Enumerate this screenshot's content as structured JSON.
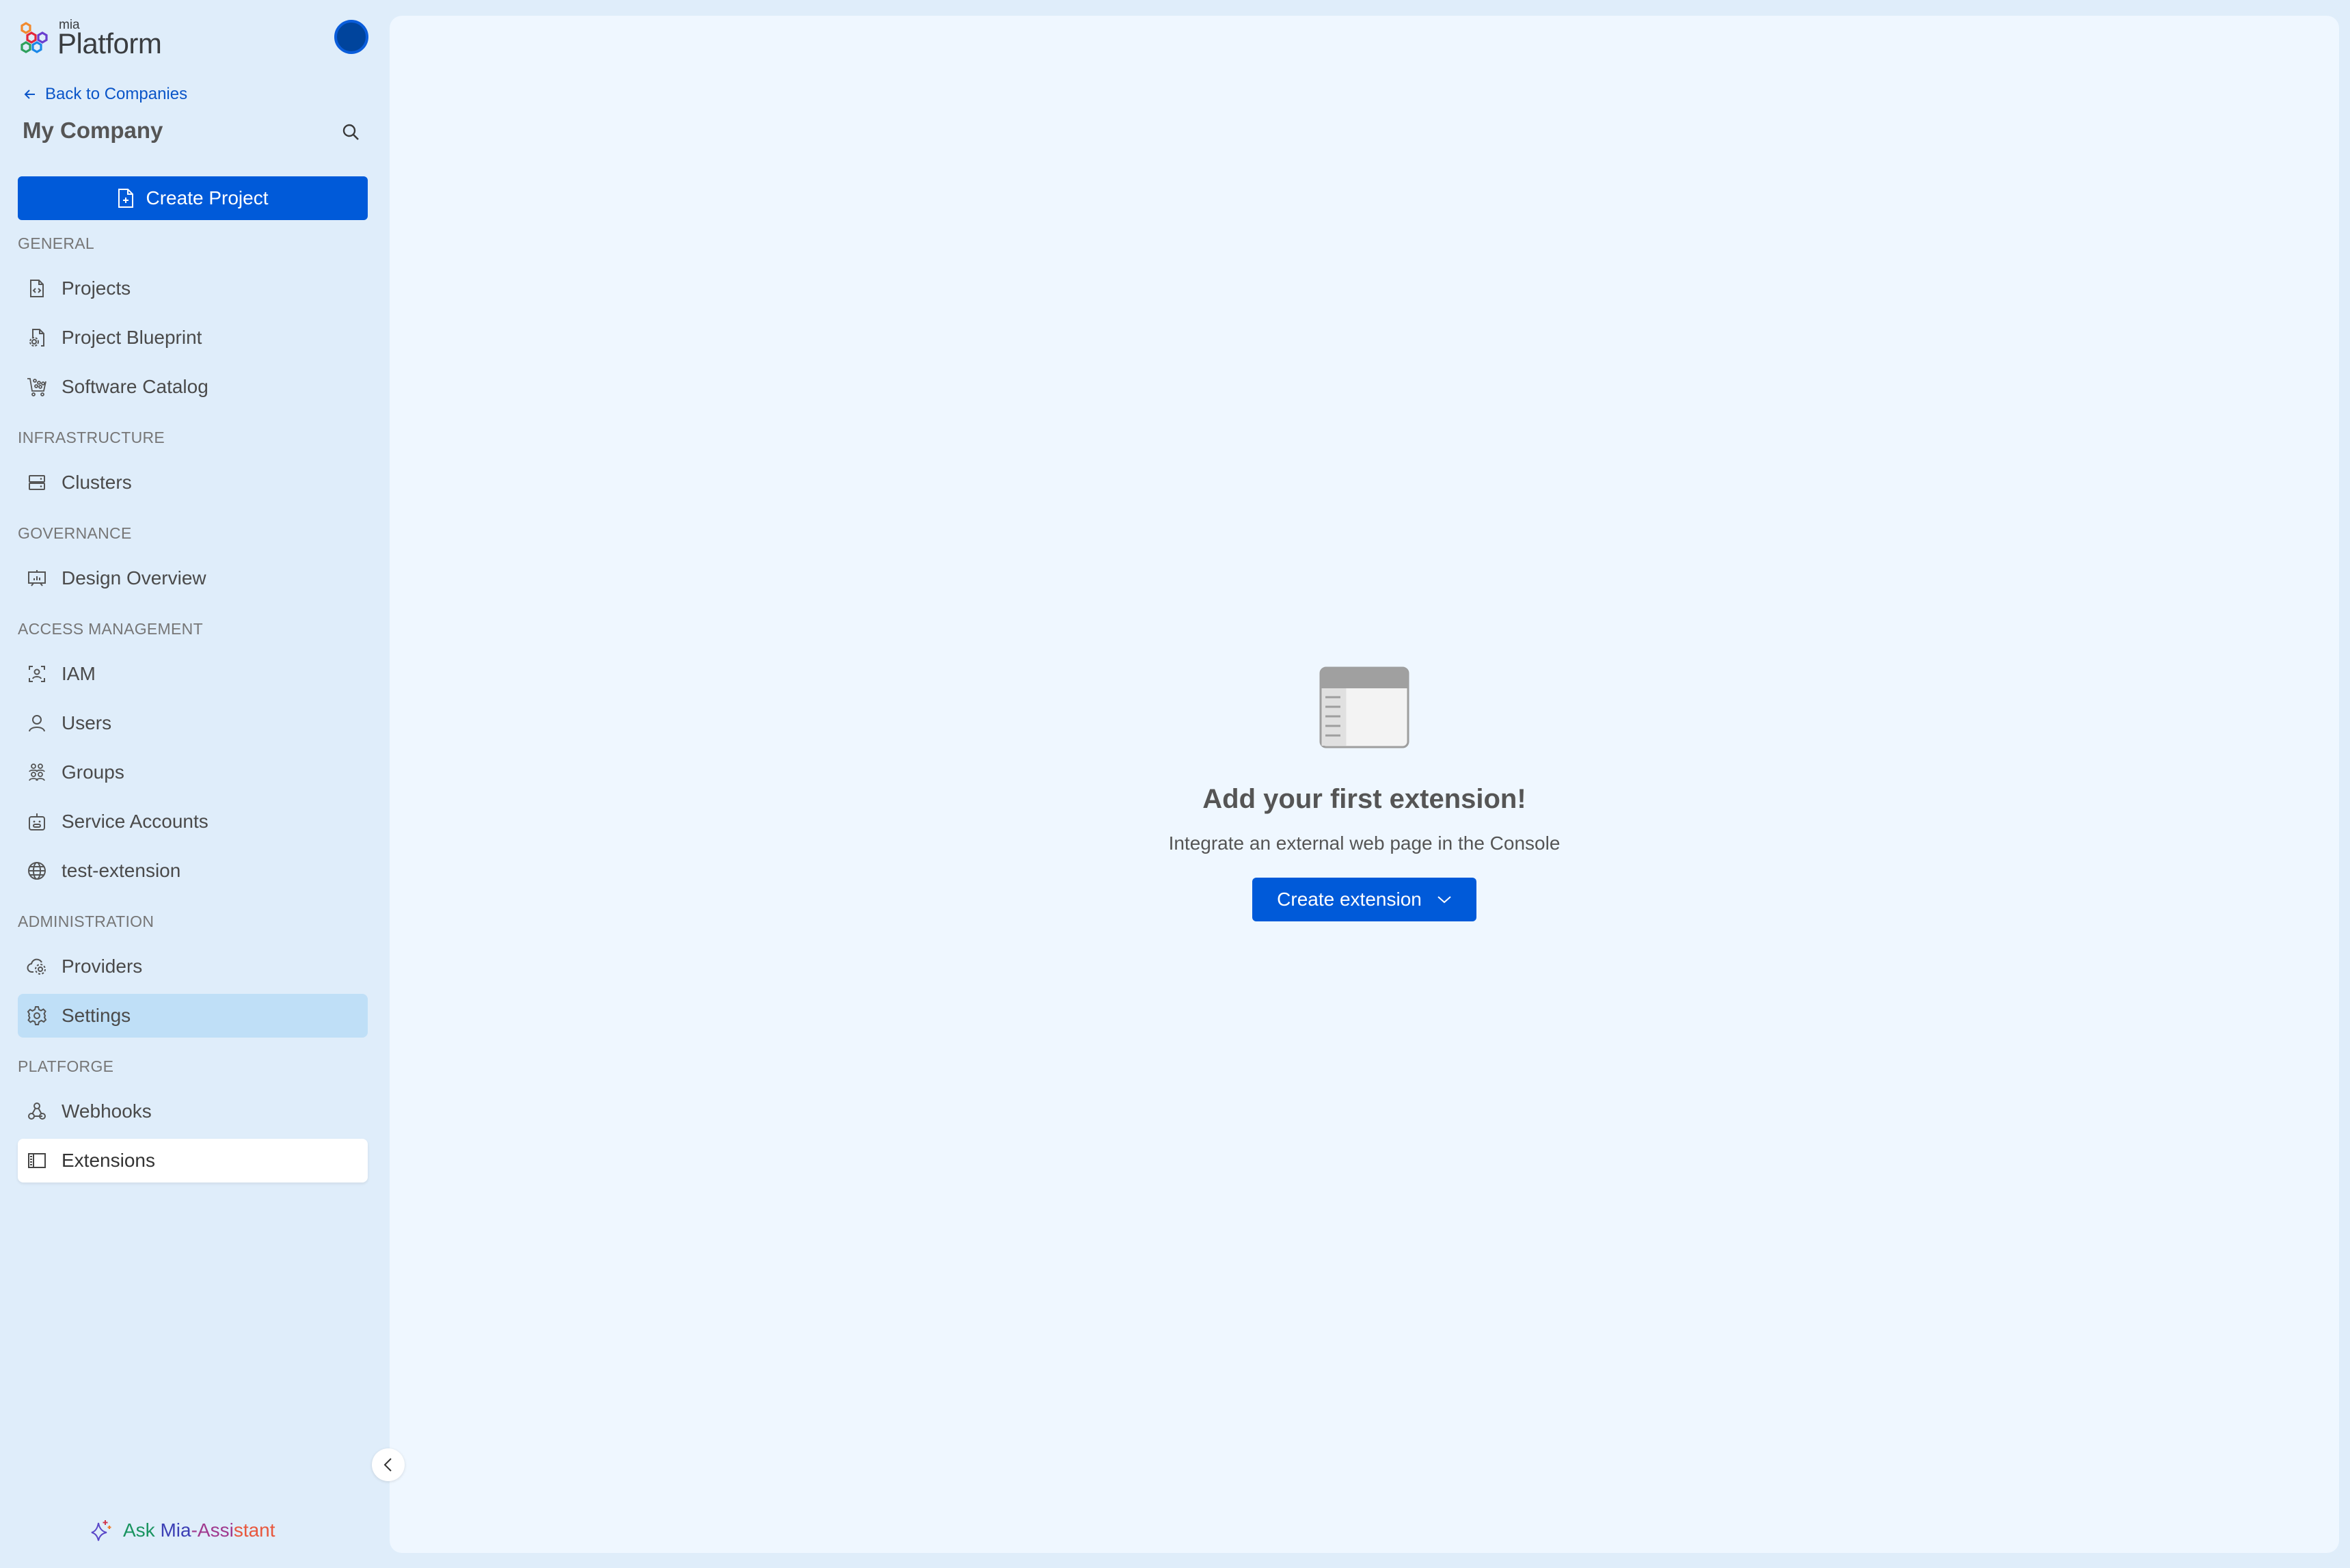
{
  "brand": {
    "small": "mia",
    "name": "Platform"
  },
  "header": {
    "back_label": "Back to Companies",
    "company_name": "My Company",
    "create_project_label": "Create Project"
  },
  "sidebar": {
    "sections": [
      {
        "title": "GENERAL",
        "items": [
          {
            "label": "Projects",
            "icon": "file-code-icon"
          },
          {
            "label": "Project Blueprint",
            "icon": "file-gear-icon"
          },
          {
            "label": "Software Catalog",
            "icon": "cart-icon"
          }
        ]
      },
      {
        "title": "INFRASTRUCTURE",
        "items": [
          {
            "label": "Clusters",
            "icon": "server-icon"
          }
        ]
      },
      {
        "title": "GOVERNANCE",
        "items": [
          {
            "label": "Design Overview",
            "icon": "presentation-chart-icon"
          }
        ]
      },
      {
        "title": "ACCESS MANAGEMENT",
        "items": [
          {
            "label": "IAM",
            "icon": "user-scan-icon"
          },
          {
            "label": "Users",
            "icon": "user-icon"
          },
          {
            "label": "Groups",
            "icon": "users-group-icon"
          },
          {
            "label": "Service Accounts",
            "icon": "robot-icon"
          },
          {
            "label": "test-extension",
            "icon": "globe-icon"
          }
        ]
      },
      {
        "title": "ADMINISTRATION",
        "items": [
          {
            "label": "Providers",
            "icon": "cloud-gear-icon"
          },
          {
            "label": "Settings",
            "icon": "gear-icon",
            "state": "hover"
          }
        ]
      },
      {
        "title": "PLATFORGE",
        "items": [
          {
            "label": "Webhooks",
            "icon": "webhook-icon"
          },
          {
            "label": "Extensions",
            "icon": "layout-sidebar-icon",
            "state": "active"
          }
        ]
      }
    ],
    "assistant": {
      "p1": "Ask ",
      "p2": "Mia",
      "p3": "-Assi",
      "p4": "stant"
    }
  },
  "main": {
    "empty_title": "Add your first extension!",
    "empty_subtitle": "Integrate an external web page in the Console",
    "create_extension_label": "Create extension"
  },
  "colors": {
    "primary": "#005ad9",
    "sidebar_bg": "#dfedfa",
    "main_bg": "#eff7ff",
    "hover_bg": "#bfdff7",
    "avatar": "#00449c"
  }
}
